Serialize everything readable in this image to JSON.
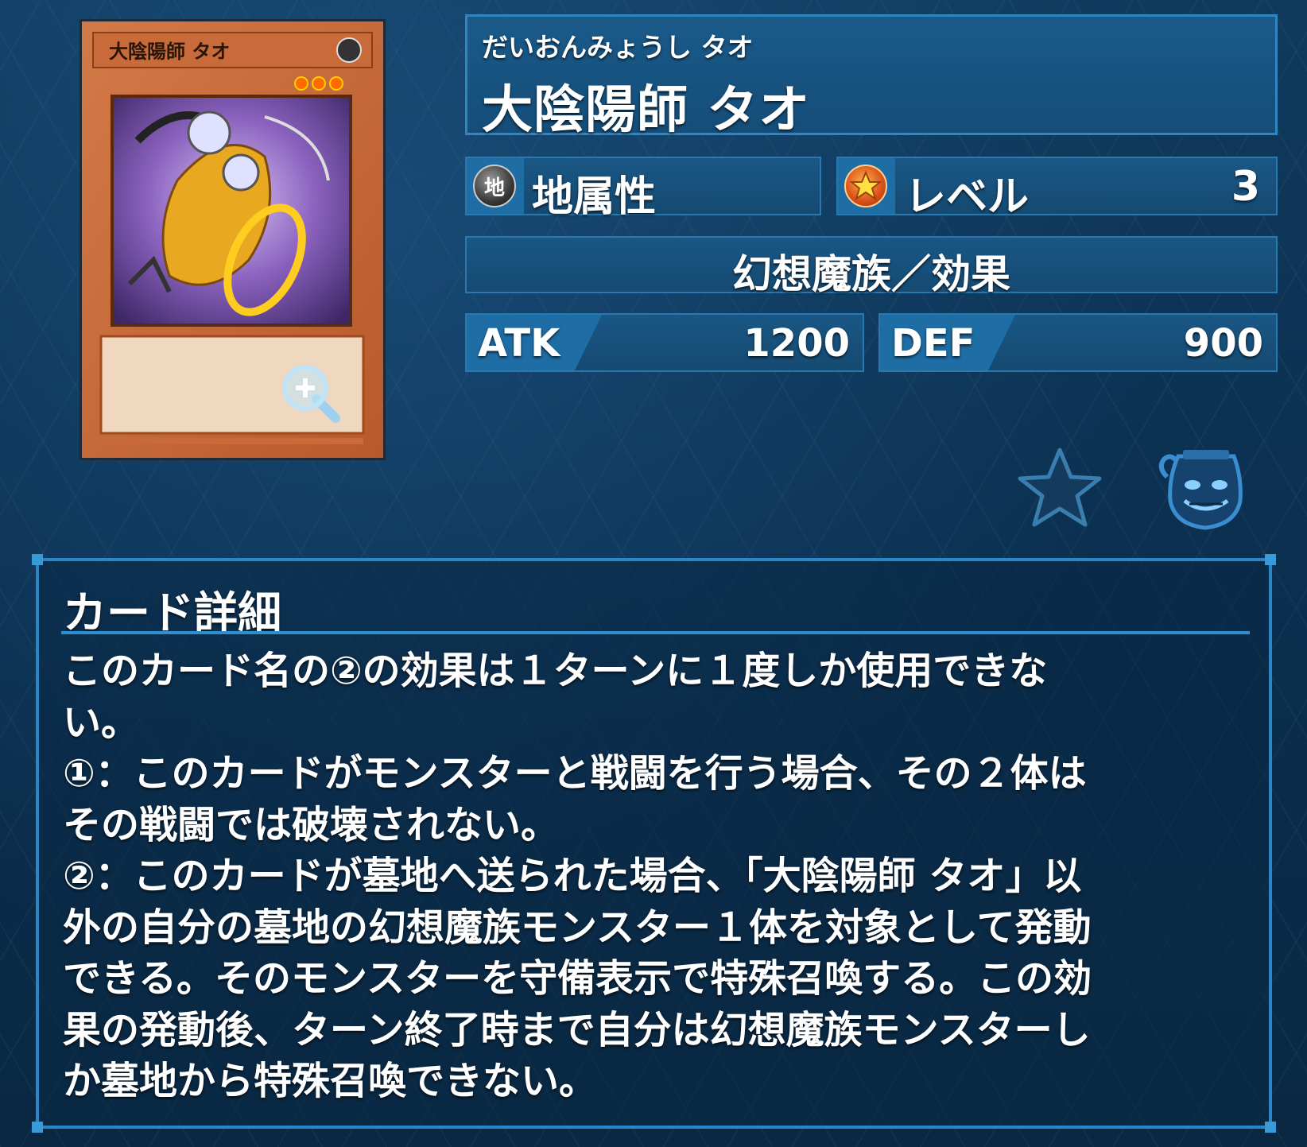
{
  "card": {
    "image_title": "大陰陽師 タオ",
    "zoom_icon": "magnifier-plus-icon"
  },
  "header": {
    "reading": "だいおんみょうし タオ",
    "name": "大陰陽師 タオ"
  },
  "attribute": {
    "icon_glyph": "地",
    "label": "地属性"
  },
  "level": {
    "icon": "star-orb-icon",
    "label": "レベル",
    "value": "3"
  },
  "type_line": "幻想魔族／効果",
  "stats": {
    "atk_label": "ATK",
    "atk_value": "1200",
    "def_label": "DEF",
    "def_value": "900"
  },
  "actions": {
    "favorite_icon": "star-icon",
    "pot_icon": "pot-of-greed-icon"
  },
  "details": {
    "title": "カード詳細",
    "text": "このカード名の②の効果は１ターンに１度しか使用できな\nい。\n①：このカードがモンスターと戦闘を行う場合、その２体は\nその戦闘では破壊されない。\n②：このカードが墓地へ送られた場合、「大陰陽師 タオ」以\n外の自分の墓地の幻想魔族モンスター１体を対象として発動\nできる。そのモンスターを守備表示で特殊召喚する。この効\n果の発動後、ターン終了時まで自分は幻想魔族モンスターし\nか墓地から特殊召喚できない。"
  },
  "colors": {
    "background": "#0b2f4f",
    "panel": "#1a5785",
    "accent": "#2a86c6"
  }
}
